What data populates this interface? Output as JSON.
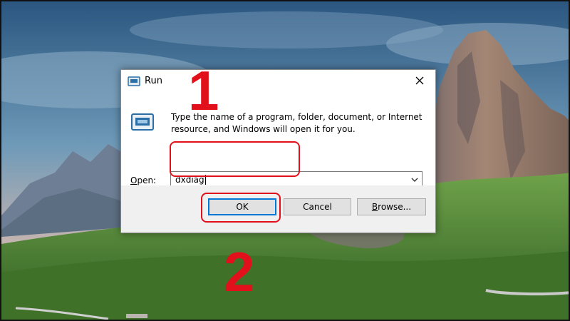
{
  "run_dialog": {
    "title": "Run",
    "description": "Type the name of a program, folder, document, or Internet resource, and Windows will open it for you.",
    "open_label": "Open:",
    "open_value": "dxdiag",
    "buttons": {
      "ok": "OK",
      "cancel": "Cancel",
      "browse": "Browse..."
    }
  },
  "annotations": {
    "step_1": "1",
    "step_2": "2",
    "color": "#e2101a"
  },
  "icons": {
    "title": "run-icon",
    "body": "program-icon",
    "close": "close-icon",
    "dropdown": "chevron-down-icon"
  },
  "colors": {
    "sky_top": "#2f5f8a",
    "sky_horizon": "#c9b8b0",
    "meadow": "#4f8a2e",
    "cliff": "#8a7462",
    "focus_border": "#0078d7"
  }
}
